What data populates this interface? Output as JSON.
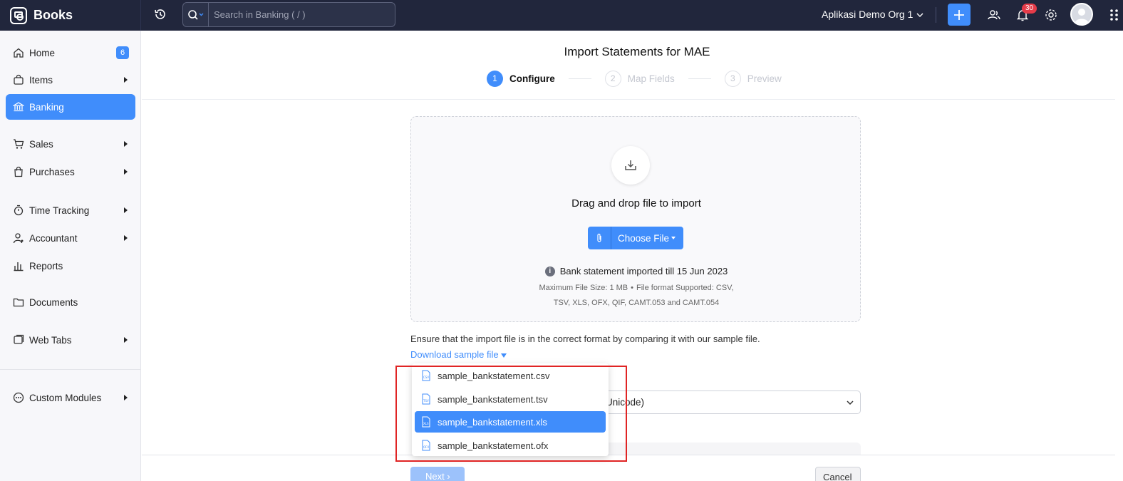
{
  "topbar": {
    "brand": "Books",
    "search_placeholder": "Search in Banking ( / )",
    "org": "Aplikasi Demo Org 1",
    "notification_count": "30"
  },
  "sidebar": {
    "items": [
      {
        "label": "Home",
        "badge": "6"
      },
      {
        "label": "Items"
      },
      {
        "label": "Banking"
      },
      {
        "label": "Sales"
      },
      {
        "label": "Purchases"
      },
      {
        "label": "Time Tracking"
      },
      {
        "label": "Accountant"
      },
      {
        "label": "Reports"
      },
      {
        "label": "Documents"
      },
      {
        "label": "Web Tabs"
      },
      {
        "label": "Custom Modules"
      }
    ]
  },
  "main": {
    "title": "Import Statements for MAE",
    "steps": [
      {
        "num": "1",
        "label": "Configure"
      },
      {
        "num": "2",
        "label": "Map Fields"
      },
      {
        "num": "3",
        "label": "Preview"
      }
    ],
    "dropzone": {
      "heading": "Drag and drop file to import",
      "choose_label": "Choose File",
      "imported_note": "Bank statement imported till 15 Jun 2023",
      "max_size": "Maximum File Size: 1 MB",
      "formats_line1": "File format Supported: CSV,",
      "formats_line2": "TSV, XLS, OFX, QIF, CAMT.053 and CAMT.054"
    },
    "ensure_text": "Ensure that the import file is in the correct format by comparing it with our sample file.",
    "download_link": "Download sample file",
    "encoding_value": "Unicode)",
    "next_label": "Next",
    "cancel_label": "Cancel"
  },
  "dropdown": {
    "items": [
      {
        "label": "sample_bankstatement.csv",
        "ext": "CSV"
      },
      {
        "label": "sample_bankstatement.tsv",
        "ext": "TSV"
      },
      {
        "label": "sample_bankstatement.xls",
        "ext": "XLS"
      },
      {
        "label": "sample_bankstatement.ofx",
        "ext": "OFX"
      }
    ],
    "selected_index": 2
  },
  "colors": {
    "topbar": "#21263c",
    "accent": "#408dfb",
    "highlight_box": "#e02424"
  }
}
